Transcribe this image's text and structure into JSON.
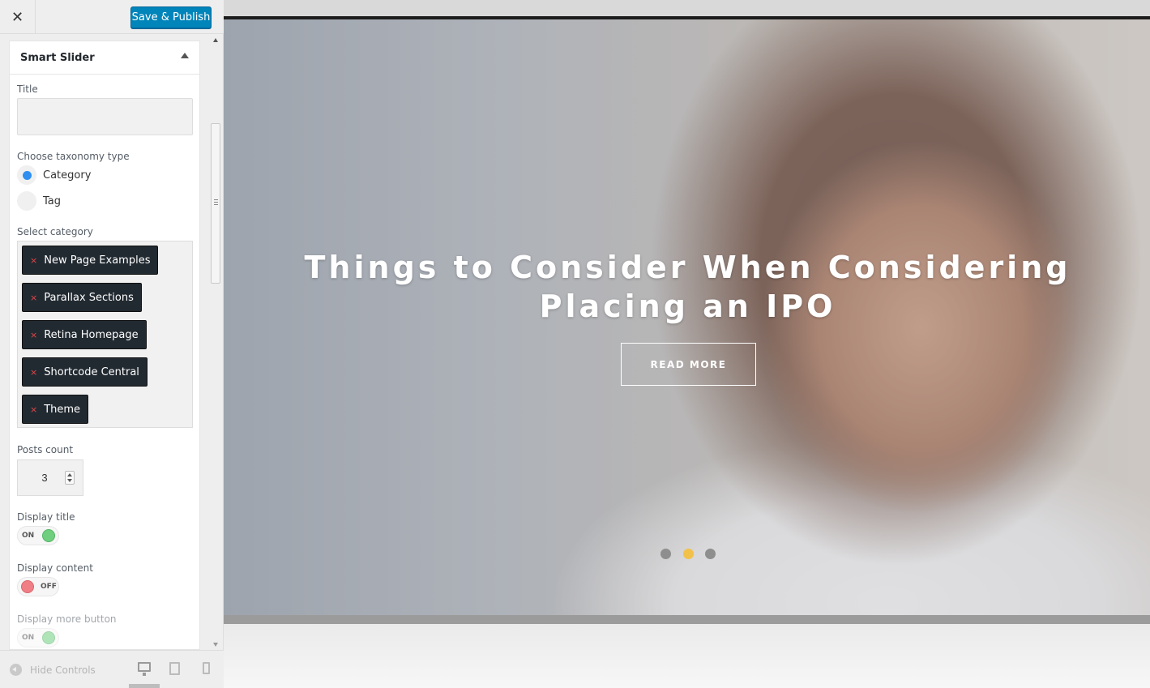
{
  "header": {
    "close_icon": "close-icon",
    "publish_label": "Save & Publish"
  },
  "panel": {
    "title": "Smart Slider",
    "title_field": {
      "label": "Title",
      "value": ""
    },
    "taxonomy": {
      "label": "Choose taxonomy type",
      "options": [
        {
          "label": "Category",
          "selected": true
        },
        {
          "label": "Tag",
          "selected": false
        }
      ]
    },
    "select_category": {
      "label": "Select category",
      "remove_glyph": "×",
      "chips": [
        "New Page Examples",
        "Parallax Sections",
        "Retina Homepage",
        "Shortcode Central",
        "Theme"
      ]
    },
    "posts_count": {
      "label": "Posts count",
      "value": "3"
    },
    "display_title": {
      "label": "Display title",
      "state": "ON"
    },
    "display_content": {
      "label": "Display content",
      "state": "OFF"
    },
    "display_more_button": {
      "label": "Display more button",
      "state": "ON"
    }
  },
  "footer": {
    "hide_controls_label": "Hide Controls",
    "devices": [
      "desktop-icon",
      "tablet-icon",
      "mobile-icon"
    ],
    "active_device": "desktop"
  },
  "preview": {
    "slide_title": "Things to Consider When Considering Placing an IPO",
    "button_label": "READ MORE",
    "dots": 3,
    "active_dot": 2,
    "colors": {
      "active_dot": "#f2c14a",
      "publish": "#0085ba",
      "toggle_on": "#6fcf7f",
      "toggle_off": "#f07f85"
    }
  }
}
